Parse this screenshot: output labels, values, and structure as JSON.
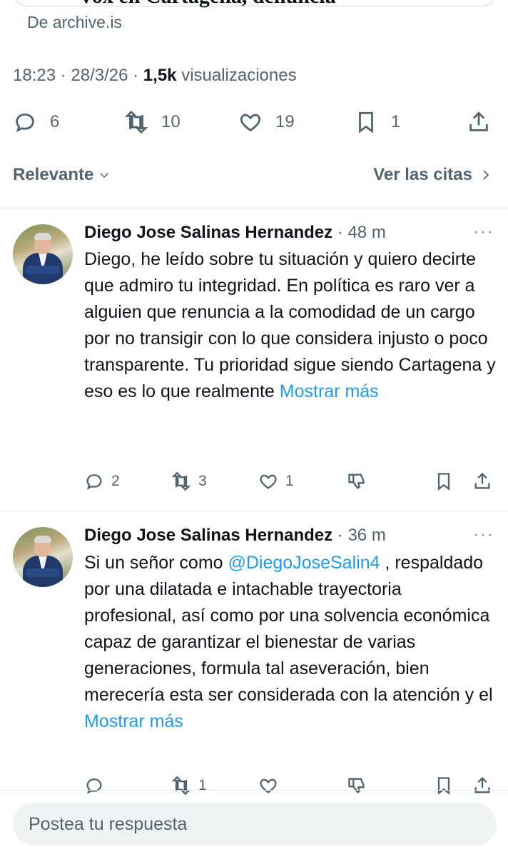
{
  "link_card": {
    "title": "Vox en Cartagena, denuncia",
    "source": "De archive.is"
  },
  "post_meta": {
    "time": "18:23",
    "date": "28/3/26",
    "views_count": "1,5k",
    "views_label": "visualizaciones"
  },
  "post_actions": {
    "replies": "6",
    "reposts": "10",
    "likes": "19",
    "bookmarks": "1"
  },
  "filters": {
    "sort_label": "Relevante",
    "quotes_label": "Ver las citas"
  },
  "replies": [
    {
      "name": "Diego Jose Salinas Hernandez",
      "time": "· 48 m",
      "text": "Diego, he leído sobre tu situación y quiero decirte que admiro tu integridad. En política es raro ver a alguien que renuncia a la comodidad de un cargo por no transigir con lo que considera injusto o poco transparente. Tu prioridad sigue siendo Cartagena y eso es lo que realmente ",
      "show_more": "Mostrar más",
      "replies": "2",
      "reposts": "3",
      "likes": "1"
    },
    {
      "name": "Diego Jose Salinas Hernandez",
      "time": "· 36 m",
      "text_before_mention": "Si un señor como ",
      "mention": "@DiegoJoseSalin4",
      "text_after_mention": " , respaldado por una dilatada e intachable trayectoria profesional, así como por una solvencia económica capaz de garantizar el bienestar de varias generaciones, formula tal aseveración, bien merecería esta ser considerada con la atención y el ",
      "show_more": "Mostrar más",
      "replies": "",
      "reposts": "1",
      "likes": ""
    }
  ],
  "composer": {
    "placeholder": "Postea tu respuesta"
  },
  "colors": {
    "text": "#0f1419",
    "muted": "#536471",
    "link": "#1d9bf0",
    "divider": "#e3e8eb",
    "composer_bg": "#eff3f4"
  },
  "icons": [
    "reply-icon",
    "repost-icon",
    "like-icon",
    "bookmark-icon",
    "share-icon",
    "chevron-down-icon",
    "chevron-right-icon",
    "more-icon",
    "analytics-icon"
  ]
}
